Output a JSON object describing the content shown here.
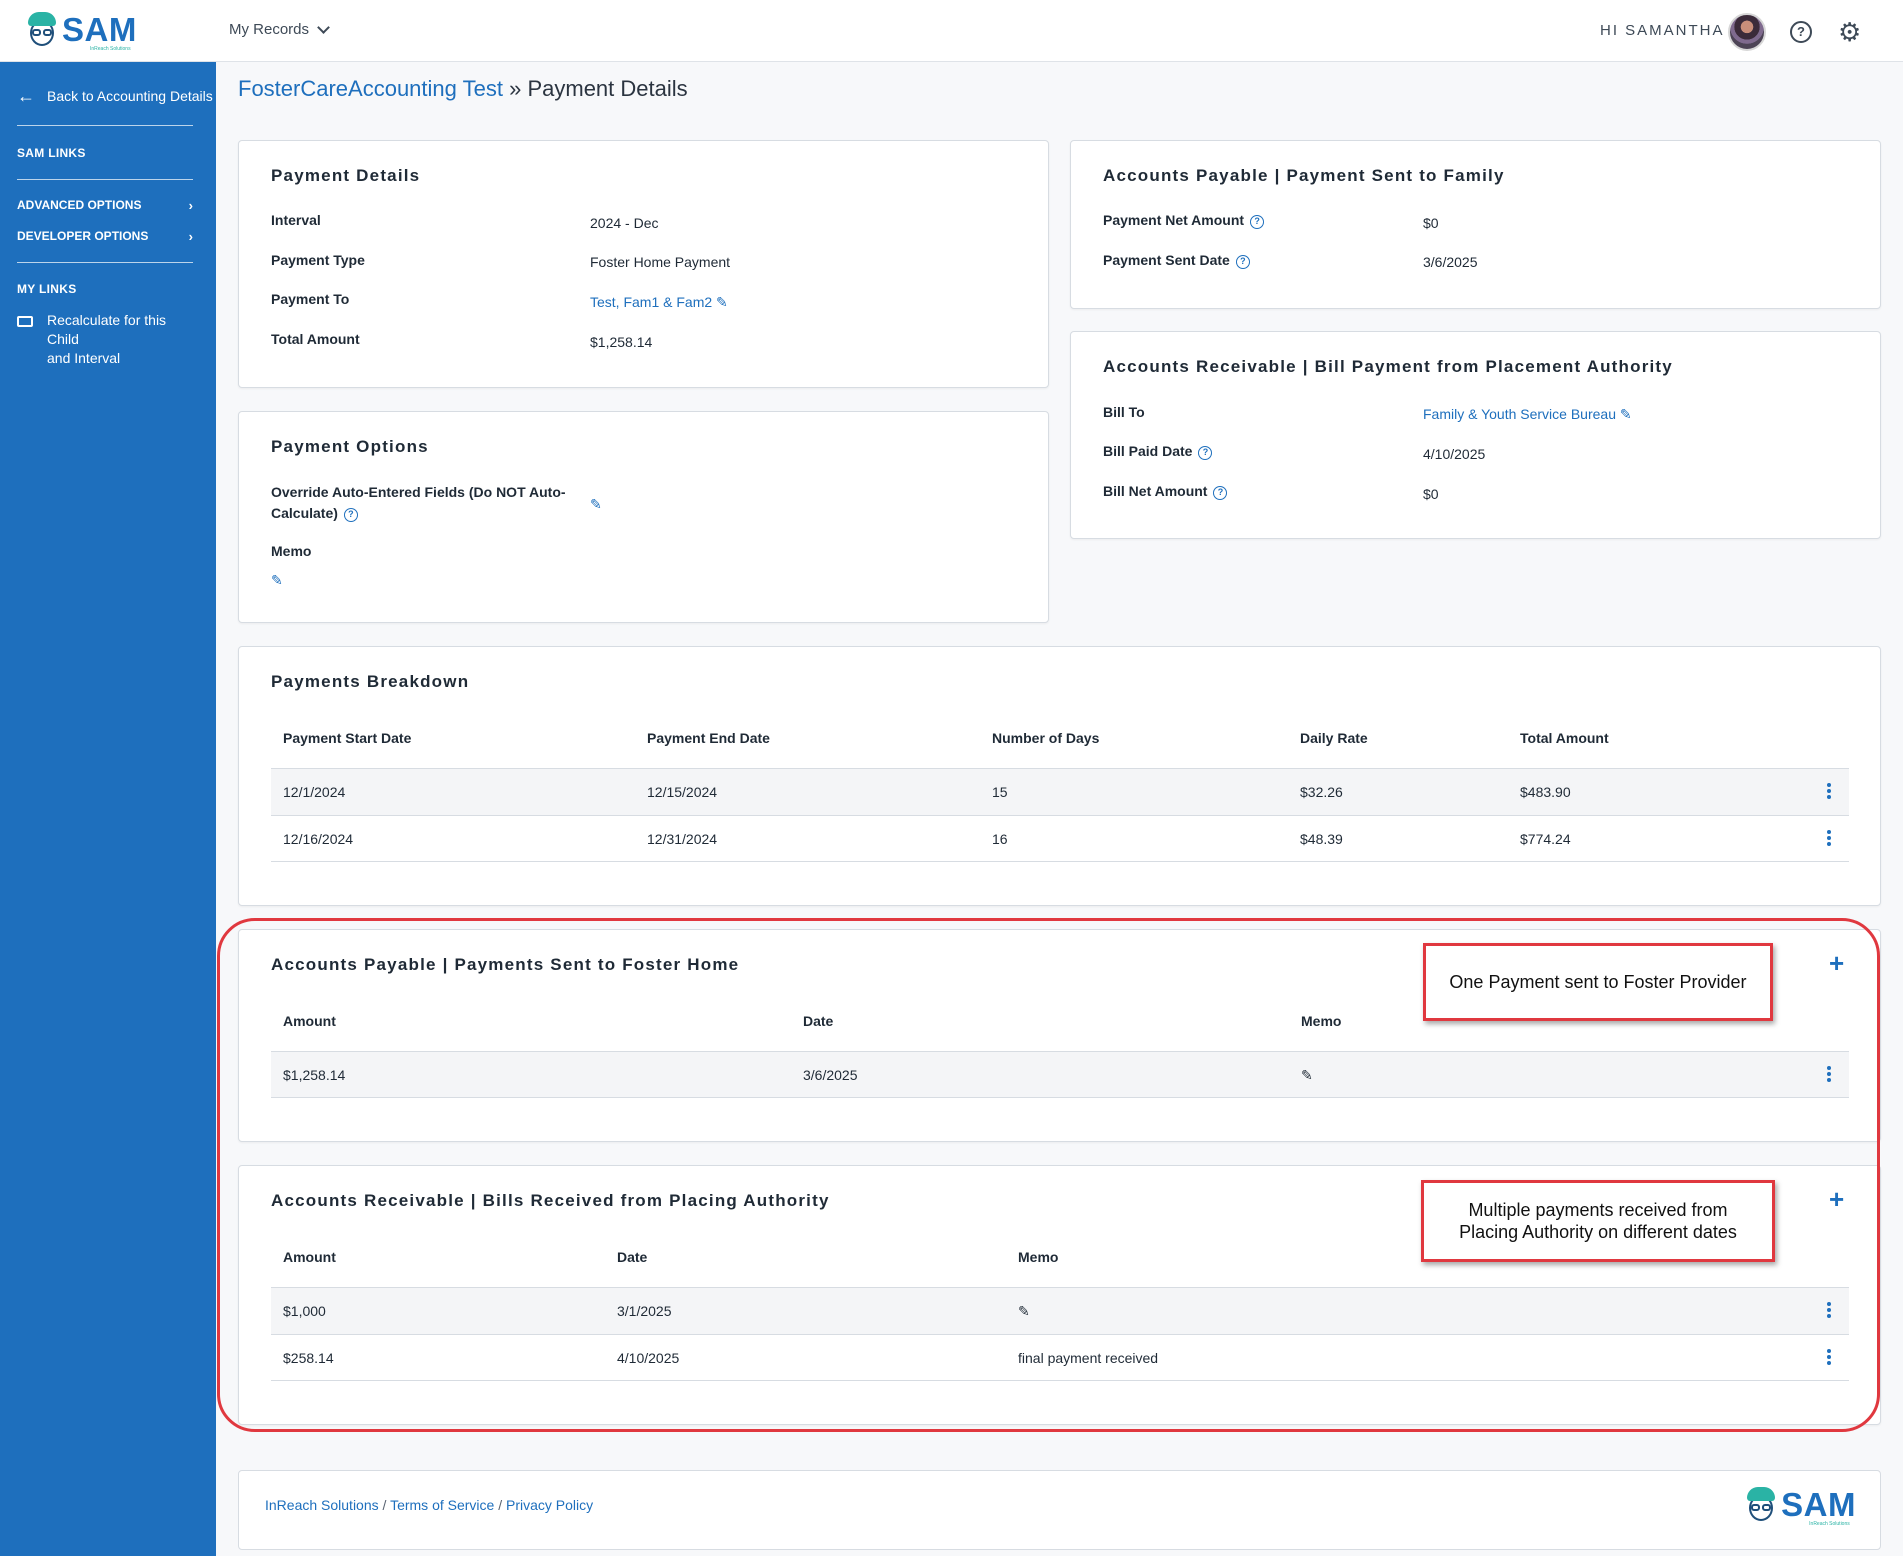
{
  "header": {
    "logo_text": "SAM",
    "logo_sub": "InReach Solutions",
    "nav_label": "My Records",
    "greeting": "HI SAMANTHA"
  },
  "sidebar": {
    "back_label": "Back to Accounting Details",
    "sam_links": "SAM LINKS",
    "advanced_options": "ADVANCED OPTIONS",
    "developer_options": "DEVELOPER OPTIONS",
    "my_links": "MY LINKS",
    "recalc_line1": "Recalculate for this Child",
    "recalc_line2": "and Interval"
  },
  "breadcrumb": {
    "parent": "FosterCareAccounting Test",
    "separator": "»",
    "current": "Payment Details"
  },
  "payment_details": {
    "title": "Payment Details",
    "interval_label": "Interval",
    "interval_value": "2024 - Dec",
    "type_label": "Payment Type",
    "type_value": "Foster Home Payment",
    "to_label": "Payment To",
    "to_value": "Test, Fam1 & Fam2",
    "total_label": "Total Amount",
    "total_value": "$1,258.14"
  },
  "payment_options": {
    "title": "Payment Options",
    "override_line1": "Override Auto-Entered Fields (Do NOT Auto-",
    "override_line2": "Calculate)",
    "memo_label": "Memo"
  },
  "ap_family": {
    "title": "Accounts Payable | Payment Sent to Family",
    "net_label": "Payment Net Amount",
    "net_value": "$0",
    "sent_label": "Payment Sent Date",
    "sent_value": "3/6/2025"
  },
  "ar_authority": {
    "title": "Accounts Receivable | Bill Payment from Placement Authority",
    "bill_to_label": "Bill To",
    "bill_to_value": "Family & Youth Service Bureau",
    "paid_label": "Bill Paid Date",
    "paid_value": "4/10/2025",
    "net_label": "Bill Net Amount",
    "net_value": "$0"
  },
  "breakdown": {
    "title": "Payments Breakdown",
    "headers": [
      "Payment Start Date",
      "Payment End Date",
      "Number of Days",
      "Daily Rate",
      "Total Amount"
    ],
    "rows": [
      [
        "12/1/2024",
        "12/15/2024",
        "15",
        "$32.26",
        "$483.90"
      ],
      [
        "12/16/2024",
        "12/31/2024",
        "16",
        "$48.39",
        "$774.24"
      ]
    ]
  },
  "ap_foster": {
    "title": "Accounts Payable | Payments Sent to Foster Home",
    "headers": [
      "Amount",
      "Date",
      "Memo"
    ],
    "rows": [
      [
        "$1,258.14",
        "3/6/2025",
        ""
      ]
    ]
  },
  "ar_bills": {
    "title": "Accounts Receivable | Bills Received from Placing Authority",
    "headers": [
      "Amount",
      "Date",
      "Memo"
    ],
    "rows": [
      [
        "$1,000",
        "3/1/2025",
        ""
      ],
      [
        "$258.14",
        "4/10/2025",
        "final payment received"
      ]
    ]
  },
  "callouts": {
    "one": "One Payment sent to Foster Provider",
    "multi_line1": "Multiple payments received from",
    "multi_line2": "Placing Authority on different dates"
  },
  "footer": {
    "link1": "InReach Solutions",
    "link2": "Terms of Service",
    "link3": "Privacy Policy",
    "separator": " / "
  },
  "colors": {
    "accent": "#1e6fbd",
    "annotation": "#e0383f",
    "teal": "#2ab3a5"
  },
  "icons": [
    "arrow-left-icon",
    "chevron-down-icon",
    "help-icon",
    "gear-icon",
    "folder-icon",
    "pencil-icon",
    "question-circle-icon",
    "kebab-icon",
    "plus-icon"
  ]
}
